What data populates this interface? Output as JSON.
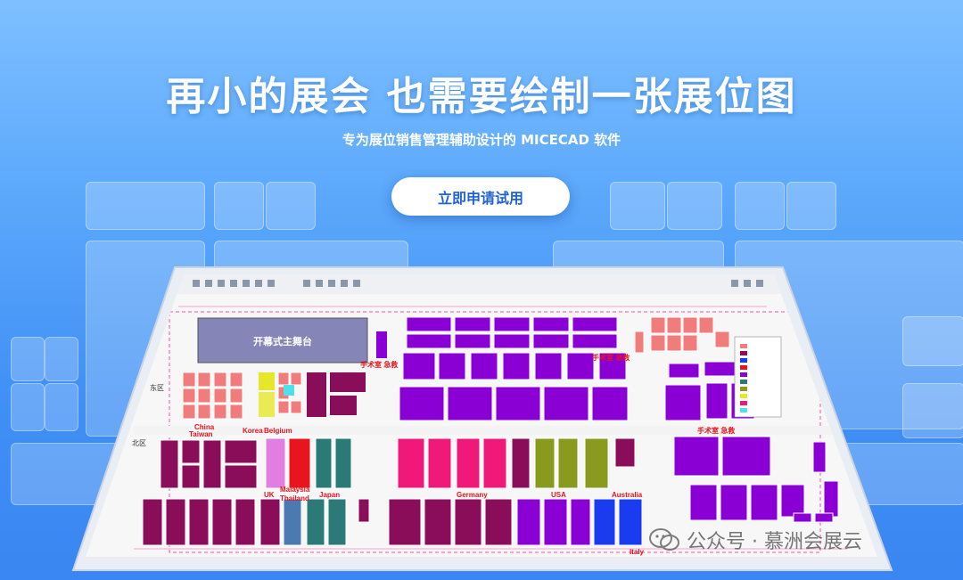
{
  "hero": {
    "title": "再小的展会 也需要绘制一张展位图",
    "subtitle": "专为展位销售管理辅助设计的 MICECAD 软件",
    "cta_label": "立即申请试用"
  },
  "floor_plan": {
    "stage_label": "开幕式主舞台",
    "emergency_labels": [
      "手术室 急救",
      "手术室 急救",
      "手术室 急救"
    ],
    "region_labels": [
      "China",
      "Taiwan",
      "Korea",
      "Belgium",
      "UK",
      "Malaysia",
      "Thailand",
      "Japan",
      "Germany",
      "USA",
      "Australia",
      "Italy"
    ],
    "side_labels": [
      "东区",
      "北区"
    ]
  },
  "watermark": {
    "text": "公众号 · 慕洲会展云"
  },
  "colors": {
    "accent": "#1d63d6",
    "purple": "#8a00d4",
    "magenta": "#f0197a",
    "olive": "#8a9a1f",
    "teal": "#2b7a78",
    "red": "#e8141e",
    "salmon": "#f08080",
    "blue": "#1a3cf0"
  }
}
